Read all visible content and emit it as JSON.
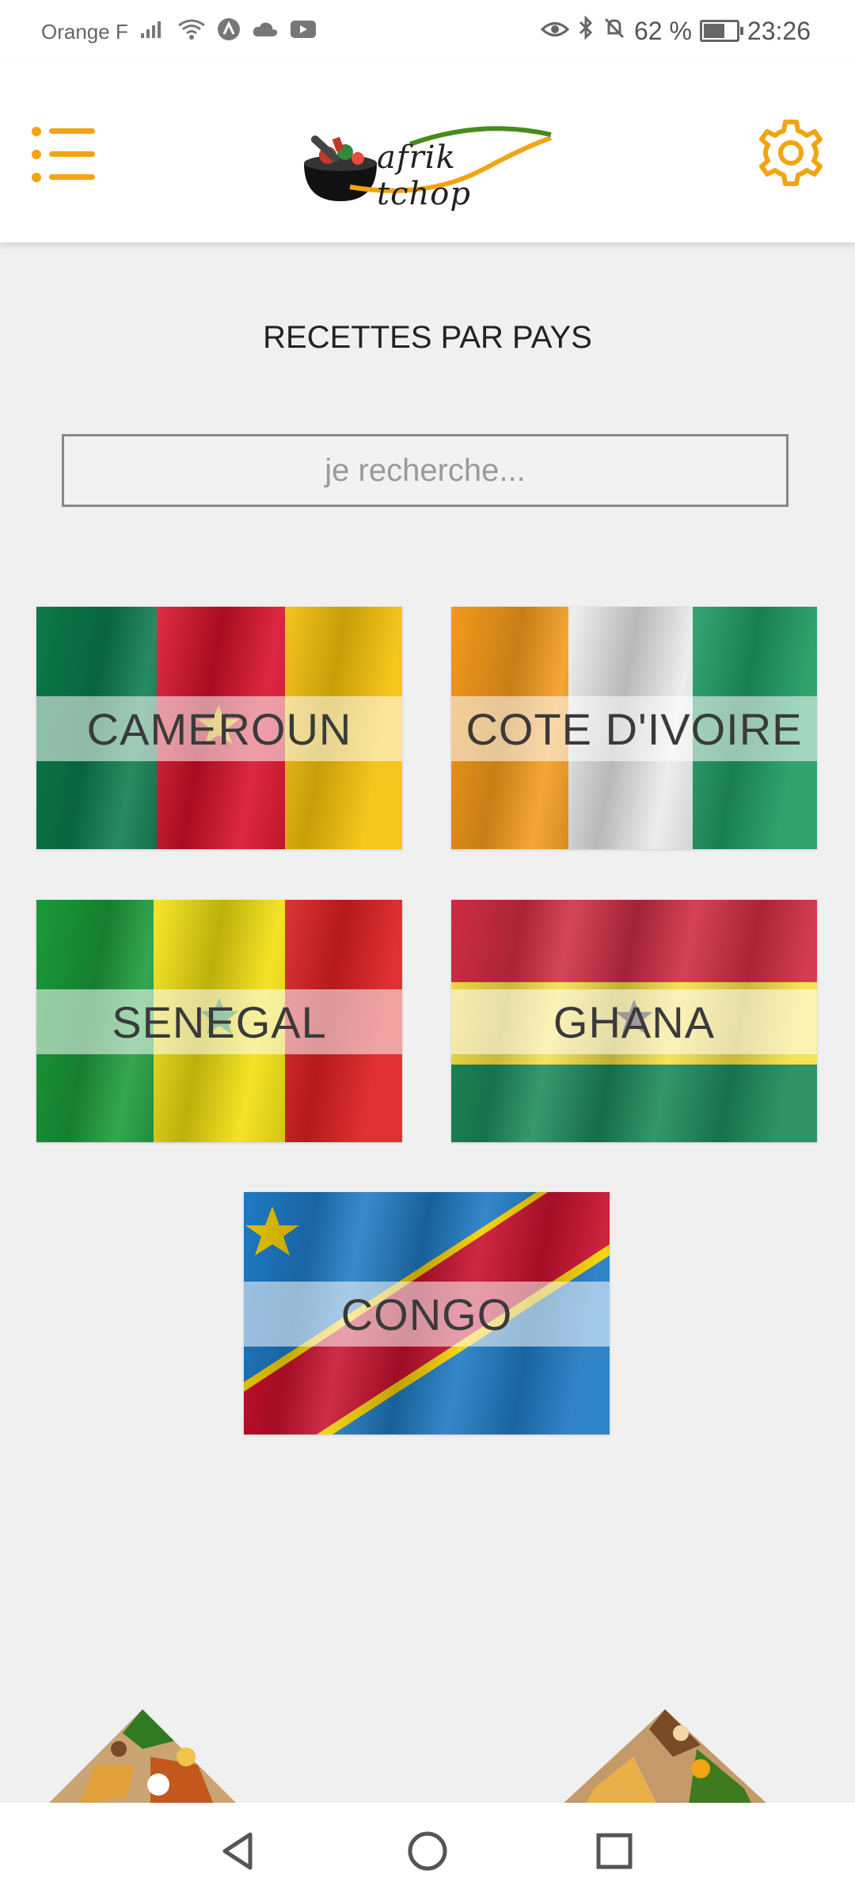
{
  "status_bar": {
    "carrier": "Orange F",
    "battery": "62 %",
    "time": "23:26"
  },
  "app": {
    "logo_text": "afrik tchop",
    "accent_color": "#f2a412"
  },
  "page": {
    "title": "RECETTES PAR PAYS"
  },
  "search": {
    "placeholder": "je recherche..."
  },
  "countries": [
    {
      "name": "CAMEROUN"
    },
    {
      "name": "COTE D'IVOIRE"
    },
    {
      "name": "SENEGAL"
    },
    {
      "name": "GHANA"
    },
    {
      "name": "CONGO"
    }
  ],
  "nav": {
    "back_icon": "back-triangle-icon",
    "home_icon": "home-circle-icon",
    "recents_icon": "recents-square-icon"
  }
}
